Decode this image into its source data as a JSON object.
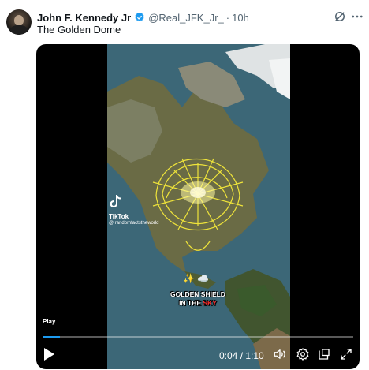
{
  "tweet": {
    "display_name": "John F. Kennedy Jr",
    "handle": "@Real_JFK_Jr_",
    "separator": "·",
    "time": "10h",
    "text": "The Golden Dome",
    "verified_color": "#1d9bf0"
  },
  "video": {
    "watermark": {
      "brand": "TikTok",
      "username": "@ randomfactstheworld"
    },
    "emoji_row": "✨ ☁️",
    "caption": {
      "line1": "GOLDEN SHIELD",
      "line2_prefix": "IN THE ",
      "line2_highlight": "SKY",
      "highlight_color": "#ff2d2d"
    },
    "play_label": "Play",
    "time_current": "0:04",
    "time_total": "1:10",
    "time_display": "0:04 / 1:10",
    "progress_fraction": 0.057,
    "icons": [
      "play-icon",
      "volume-icon",
      "settings-icon",
      "popout-icon",
      "fullscreen-icon"
    ]
  }
}
